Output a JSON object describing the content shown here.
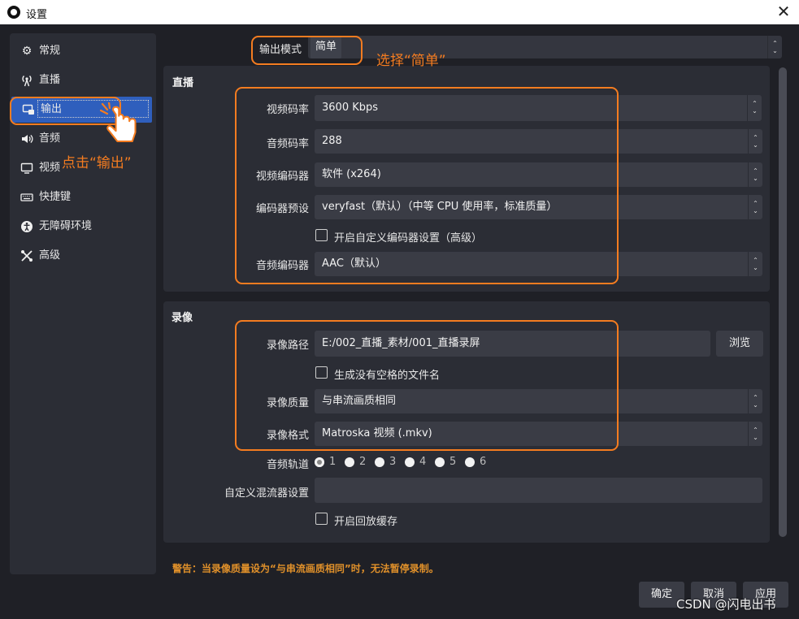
{
  "window": {
    "title": "设置",
    "close_glyph": "✕"
  },
  "sidebar": {
    "items": [
      {
        "label": "常规",
        "icon": "gear-icon",
        "glyph": "⚙"
      },
      {
        "label": "直播",
        "icon": "broadcast-icon",
        "glyph": "📡"
      },
      {
        "label": "输出",
        "icon": "output-icon",
        "glyph": "▣"
      },
      {
        "label": "音频",
        "icon": "speaker-icon",
        "glyph": "🔊"
      },
      {
        "label": "视频",
        "icon": "monitor-icon",
        "glyph": "🖵"
      },
      {
        "label": "快捷键",
        "icon": "keyboard-icon",
        "glyph": "⌨"
      },
      {
        "label": "无障碍环境",
        "icon": "accessibility-icon",
        "glyph": "♿"
      },
      {
        "label": "高级",
        "icon": "tools-icon",
        "glyph": "✂"
      }
    ],
    "active": "输出"
  },
  "output_mode": {
    "label": "输出模式",
    "value": "简单"
  },
  "stream": {
    "title": "直播",
    "video_bitrate": {
      "label": "视频码率",
      "value": "3600 Kbps"
    },
    "audio_bitrate": {
      "label": "音频码率",
      "value": "288"
    },
    "video_encoder": {
      "label": "视频编码器",
      "value": "软件 (x264)"
    },
    "encoder_preset": {
      "label": "编码器预设",
      "value": "veryfast（默认）（中等 CPU 使用率，标准质量）"
    },
    "custom_encoder": {
      "label": "开启自定义编码器设置（高级）",
      "checked": false
    },
    "audio_encoder": {
      "label": "音频编码器",
      "value": "AAC（默认）"
    }
  },
  "recording": {
    "title": "录像",
    "path": {
      "label": "录像路径",
      "value": "E:/002_直播_素材/001_直播录屏",
      "browse": "浏览"
    },
    "no_space_filename": {
      "label": "生成没有空格的文件名",
      "checked": false
    },
    "quality": {
      "label": "录像质量",
      "value": "与串流画质相同"
    },
    "format": {
      "label": "录像格式",
      "value": "Matroska 视频 (.mkv)"
    },
    "audio_track": {
      "label": "音频轨道",
      "tracks": [
        "1",
        "2",
        "3",
        "4",
        "5",
        "6"
      ],
      "selected": "1"
    },
    "custom_muxer": {
      "label": "自定义混流器设置",
      "value": ""
    },
    "replay_buffer": {
      "label": "开启回放缓存",
      "checked": false
    }
  },
  "warning": "警告：当录像质量设为“与串流画质相同”时，无法暂停录制。",
  "buttons": {
    "ok": "确定",
    "cancel": "取消",
    "apply": "应用"
  },
  "annotations": {
    "select_simple": "选择“简单”",
    "click_output": "点击“输出”",
    "color": "#f47c20"
  },
  "watermark": "CSDN @闪电出书"
}
